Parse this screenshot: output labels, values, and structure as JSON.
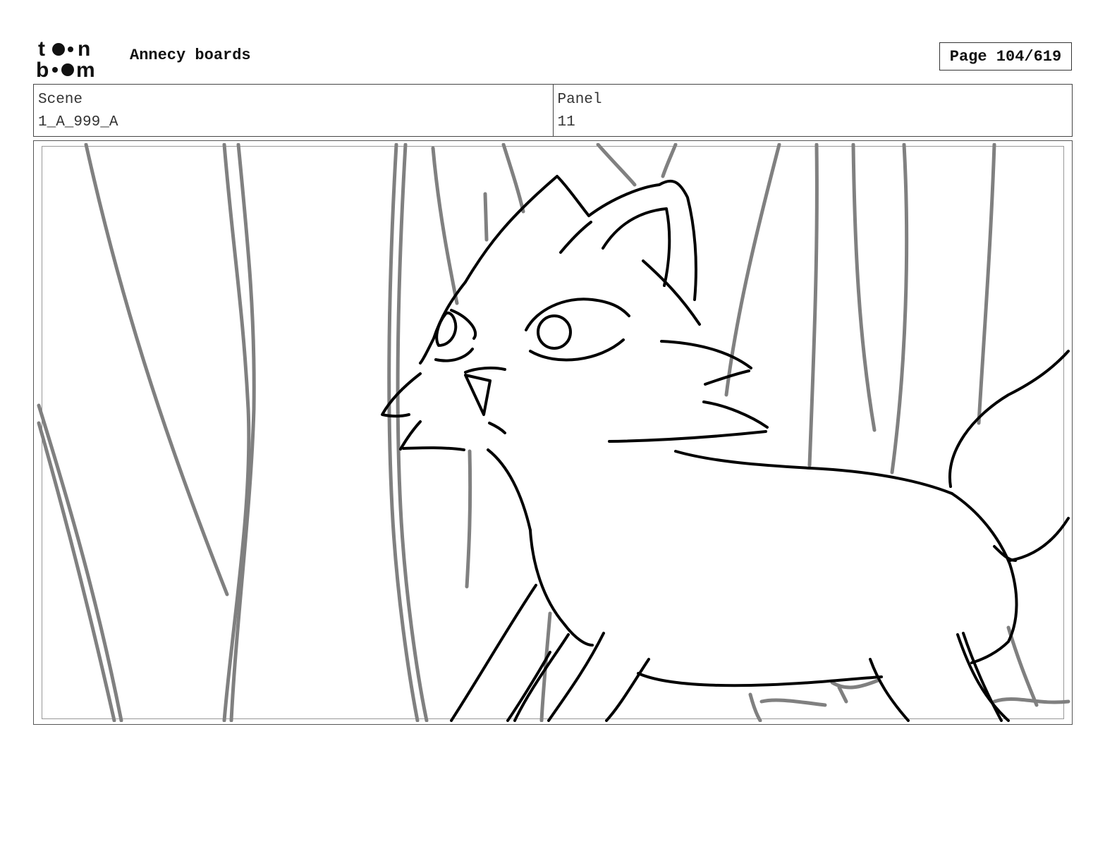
{
  "header": {
    "logo_text": "toon boom",
    "project_title": "Annecy boards",
    "page_label": "Page 104/619"
  },
  "info": {
    "scene_label": "Scene",
    "scene_value": "1_A_999_A",
    "panel_label": "Panel",
    "panel_value": "11"
  },
  "colors": {
    "background_strokes": "#808080",
    "character_strokes": "#000000",
    "frame_border": "#555555"
  }
}
